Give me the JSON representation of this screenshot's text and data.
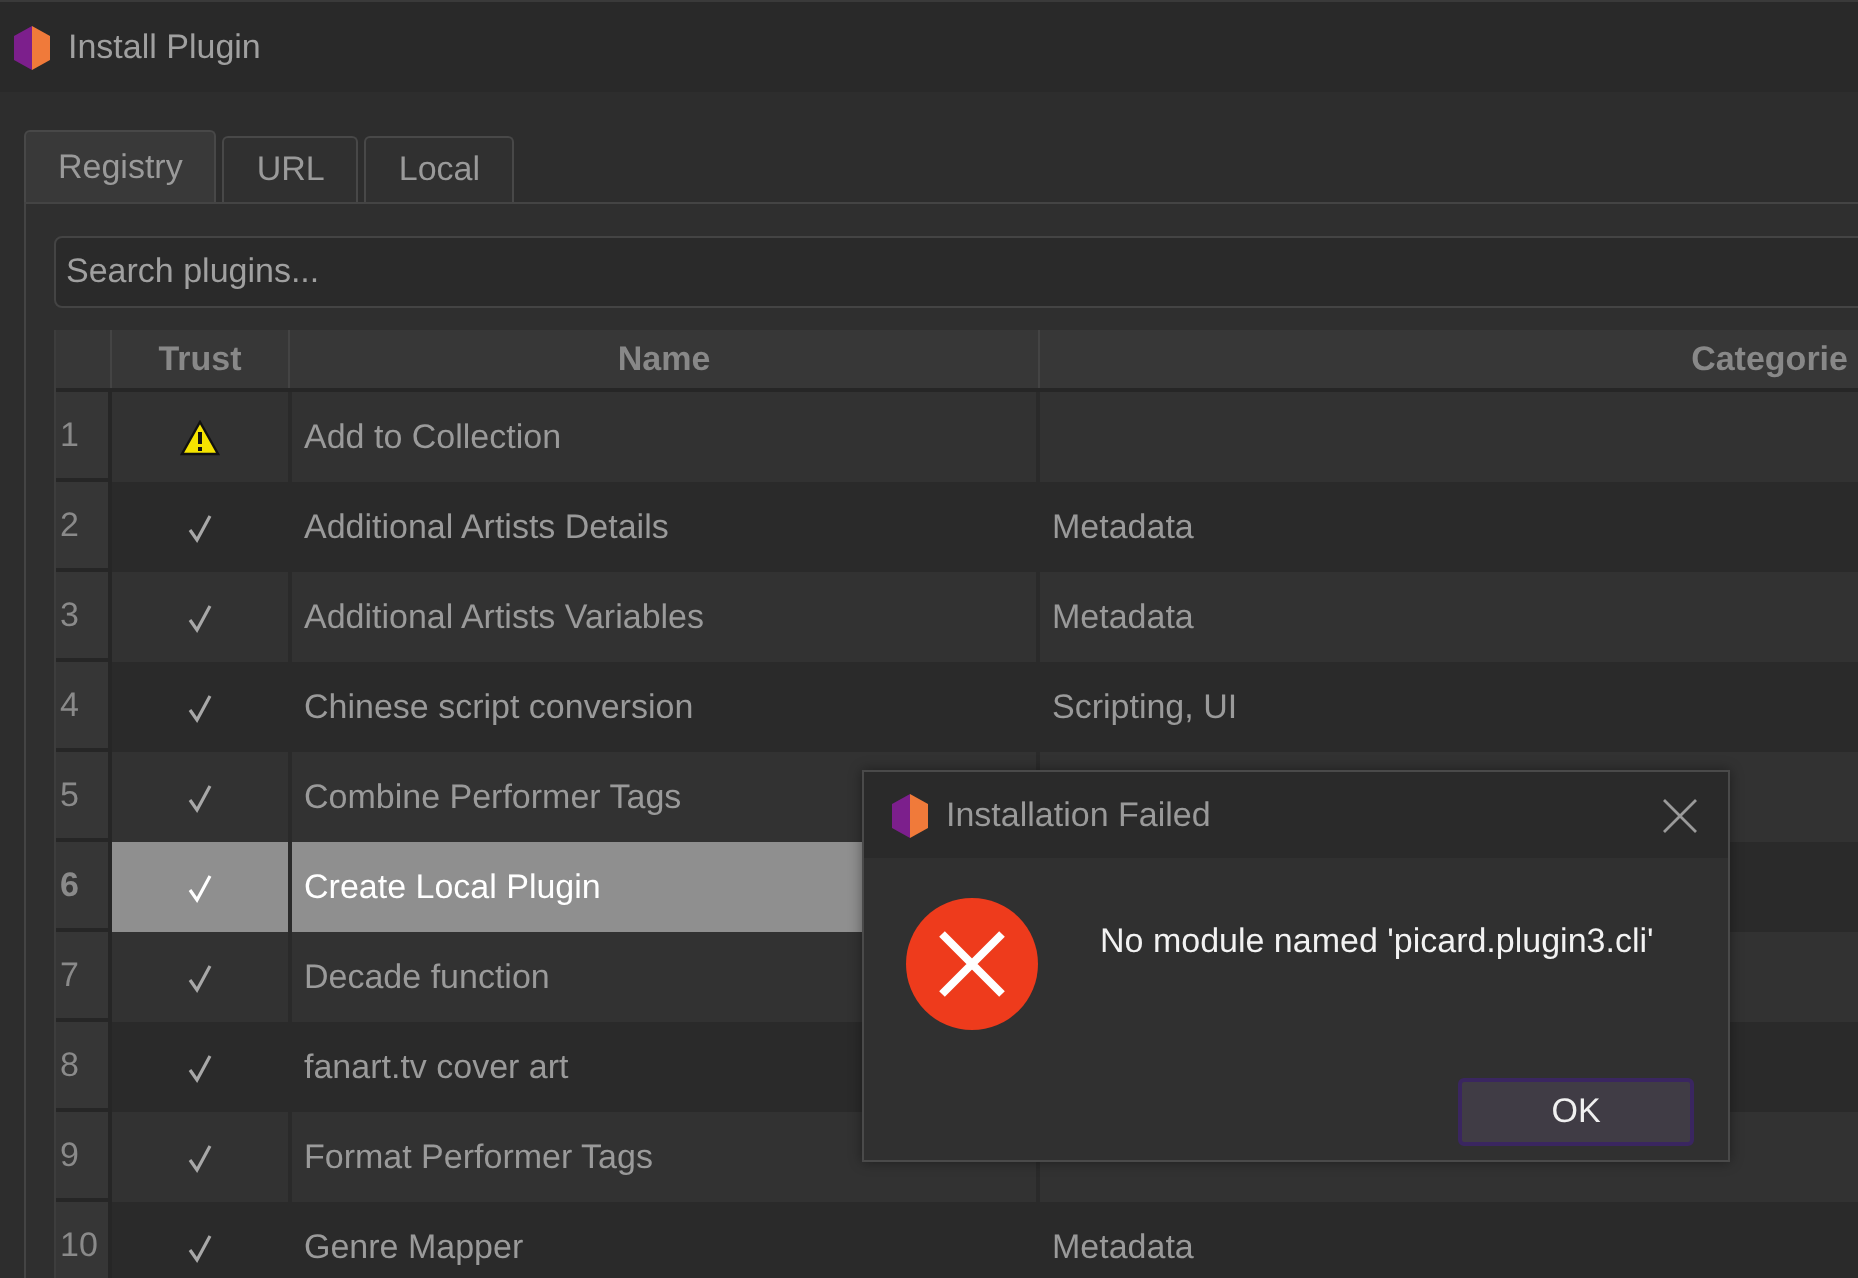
{
  "window": {
    "title": "Install Plugin"
  },
  "tabs": [
    {
      "label": "Registry",
      "selected": true
    },
    {
      "label": "URL",
      "selected": false
    },
    {
      "label": "Local",
      "selected": false
    }
  ],
  "search": {
    "placeholder": "Search plugins..."
  },
  "table": {
    "columns": [
      "Trust",
      "Name",
      "Categorie"
    ],
    "rows": [
      {
        "number": "1",
        "kind": "warning",
        "name": "Add to Collection",
        "selected": false
      },
      {
        "number": "2",
        "kind": "trusted",
        "name": "Additional Artists Details",
        "category": "Metadata",
        "selected": false
      },
      {
        "number": "3",
        "kind": "trusted",
        "name": "Additional Artists Variables",
        "category": "Metadata",
        "selected": false
      },
      {
        "number": "4",
        "kind": "trusted",
        "name": "Chinese script conversion",
        "category": "Scripting, UI",
        "selected": false
      },
      {
        "number": "5",
        "kind": "trusted",
        "name": "Combine Performer Tags",
        "selected": false
      },
      {
        "number": "6",
        "kind": "trusted",
        "name": "Create Local Plugin",
        "selected": true
      },
      {
        "number": "7",
        "kind": "trusted",
        "name": "Decade function",
        "selected": false
      },
      {
        "number": "8",
        "kind": "trusted",
        "name": "fanart.tv cover art",
        "selected": false
      },
      {
        "number": "9",
        "kind": "trusted",
        "name": "Format Performer Tags",
        "selected": false
      },
      {
        "number": "10",
        "kind": "trusted",
        "name": "Genre Mapper",
        "category": "Metadata",
        "selected": false
      }
    ]
  },
  "dialog": {
    "title": "Installation Failed",
    "kind": "error",
    "message": "No module named 'picard.plugin3.cli'",
    "button": "OK"
  }
}
